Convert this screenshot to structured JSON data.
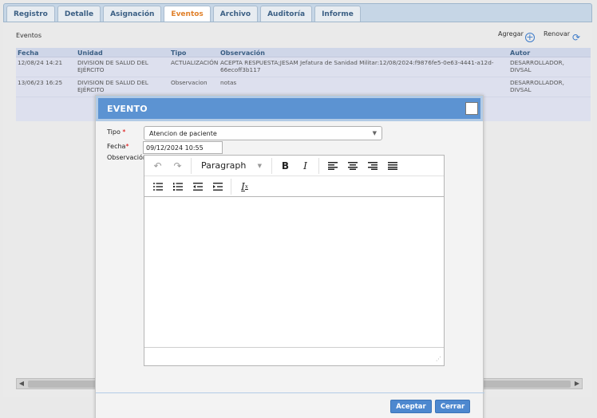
{
  "tabs": [
    {
      "label": "Registro"
    },
    {
      "label": "Detalle"
    },
    {
      "label": "Asignación"
    },
    {
      "label": "Eventos"
    },
    {
      "label": "Archivo"
    },
    {
      "label": "Auditoría"
    },
    {
      "label": "Informe"
    }
  ],
  "active_tab": "Eventos",
  "accent_color": "#e0802a",
  "section": {
    "title": "Eventos"
  },
  "actions": {
    "add_label": "Agregar",
    "add_icon": "plus-circle-icon",
    "renew_label": "Renovar",
    "renew_icon": "refresh-icon"
  },
  "table": {
    "headers": [
      "Fecha",
      "Unidad",
      "Tipo",
      "Observación",
      "Autor"
    ],
    "rows": [
      {
        "fecha": "12/08/24 14:21",
        "unidad": "DIVISION DE SALUD DEL EJÉRCITO",
        "tipo": "ACTUALIZACIÓN",
        "observacion": "ACEPTA RESPUESTA;JESAM Jefatura de Sanidad Militar:12/08/2024:f9876fe5-0e63-4441-a12d-66ecoff3b117",
        "autor": "DESARROLLADOR, DIVSAL"
      },
      {
        "fecha": "13/06/23 16:25",
        "unidad": "DIVISION DE SALUD DEL EJÉRCITO",
        "tipo": "Observacion",
        "observacion": "notas",
        "autor": "DESARROLLADOR, DIVSAL"
      }
    ]
  },
  "modal": {
    "title": "EVENTO",
    "tipo_label": "Tipo",
    "tipo_value": "Atencion de paciente",
    "fecha_label": "Fecha",
    "fecha_value": "09/12/2024 10:55",
    "observacion_label": "Observación",
    "required_mark": "*",
    "editor": {
      "format_value": "Paragraph",
      "toolbar": [
        "undo-icon",
        "redo-icon",
        "bold-icon",
        "italic-icon",
        "align-left-icon",
        "align-center-icon",
        "align-right-icon",
        "align-justify-icon",
        "bullet-list-icon",
        "numbered-list-icon",
        "outdent-icon",
        "indent-icon",
        "clear-format-icon"
      ]
    },
    "accept_label": "Aceptar",
    "close_label": "Cerrar"
  }
}
